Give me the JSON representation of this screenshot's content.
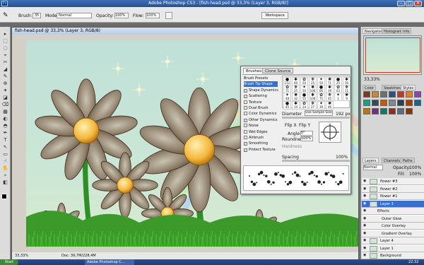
{
  "app": {
    "title": "Adobe Photoshop CS3 - [fish-head.psd @ 33,3% (Layer 3, RGB/8)]",
    "logo": "Ps",
    "min": "–",
    "max": "□",
    "close": "✕"
  },
  "options": {
    "brush_label": "Brush:",
    "brush_size": "35",
    "mode_label": "Mode:",
    "mode_value": "Normal",
    "opacity_label": "Opacity:",
    "opacity_value": "100%",
    "flow_label": "Flow:",
    "flow_value": "100%",
    "workspace": "Workspace"
  },
  "doc": {
    "title": "fish-head.psd @ 33,3% (Layer 3, RGB/8)",
    "zoom": "33,33%",
    "info": "Doc: 39,7M/228,4M"
  },
  "brushes_panel": {
    "tabs": [
      "Brushes",
      "Clone Source"
    ],
    "items": [
      {
        "label": "Brush Presets",
        "check": ""
      },
      {
        "label": "Brush Tip Shape",
        "check": ""
      },
      {
        "label": "Shape Dynamics",
        "check": "✓"
      },
      {
        "label": "Scattering",
        "check": "✓"
      },
      {
        "label": "Texture",
        "check": ""
      },
      {
        "label": "Dual Brush",
        "check": ""
      },
      {
        "label": "Color Dynamics",
        "check": ""
      },
      {
        "label": "Other Dynamics",
        "check": "✓"
      },
      {
        "label": "Noise",
        "check": ""
      },
      {
        "label": "Wet Edges",
        "check": ""
      },
      {
        "label": "Airbrush",
        "check": ""
      },
      {
        "label": "Smoothing",
        "check": "✓"
      },
      {
        "label": "Protect Texture",
        "check": "✓"
      }
    ],
    "tips": [
      "112",
      "60",
      "50",
      "25",
      "50",
      "71",
      "25",
      "50",
      "71",
      "25",
      "50",
      "100",
      "66",
      "39",
      "63",
      "11",
      "48",
      "32",
      "55",
      "100",
      "75",
      "45",
      "1",
      "9",
      "45",
      "14",
      "24",
      "27",
      "39",
      "46"
    ],
    "diameter_label": "Diameter",
    "use_sample": "Use Sample Size",
    "diameter_value": "192 px",
    "flip_x": "Flip X",
    "flip_y": "Flip Y",
    "angle_label": "Angle:",
    "angle_value": "0°",
    "roundness_label": "Roundness:",
    "roundness_value": "100%",
    "hardness_label": "Hardness",
    "spacing_label": "Spacing",
    "spacing_value": "100%"
  },
  "right": {
    "nav_tabs": [
      "Navigator",
      "Histogram",
      "Info"
    ],
    "nav_zoom": "33,33%",
    "color_tabs": [
      "Color",
      "Swatches",
      "Styles"
    ],
    "layer_tabs": [
      "Layers",
      "Channels",
      "Paths"
    ],
    "blend": "Normal",
    "opacity_label": "Opacity:",
    "opacity_value": "100%",
    "fill_label": "Fill:",
    "fill_value": "100%",
    "layers": [
      {
        "name": "flower #3",
        "sel": false
      },
      {
        "name": "flower #2",
        "sel": false
      },
      {
        "name": "flower #1",
        "sel": false
      },
      {
        "name": "Layer 3",
        "sel": true
      },
      {
        "name": "Effects",
        "sel": false
      },
      {
        "name": "Outer Glow",
        "sel": false
      },
      {
        "name": "Color Overlay",
        "sel": false
      },
      {
        "name": "Gradient Overlay",
        "sel": false
      },
      {
        "name": "Layer 4",
        "sel": false
      },
      {
        "name": "Layer 1",
        "sel": false
      },
      {
        "name": "Background",
        "sel": false
      }
    ],
    "style_colors": [
      "#7a3d1a",
      "#c48a3a",
      "#6e6e6e",
      "#2f4f7f",
      "#c0392b",
      "#e67e22",
      "#8e44ad",
      "#16a085",
      "#34495e",
      "#d35400",
      "#7f8c8d",
      "#2c3e50",
      "#a04000",
      "#1f618d",
      "#b9770e",
      "#6c3483",
      "#117a65",
      "#922b21",
      "#5d6d7e",
      "#873600"
    ]
  },
  "taskbar": {
    "start": "Start",
    "app_button": "Adobe Photoshop C...",
    "clock": "22:32"
  }
}
